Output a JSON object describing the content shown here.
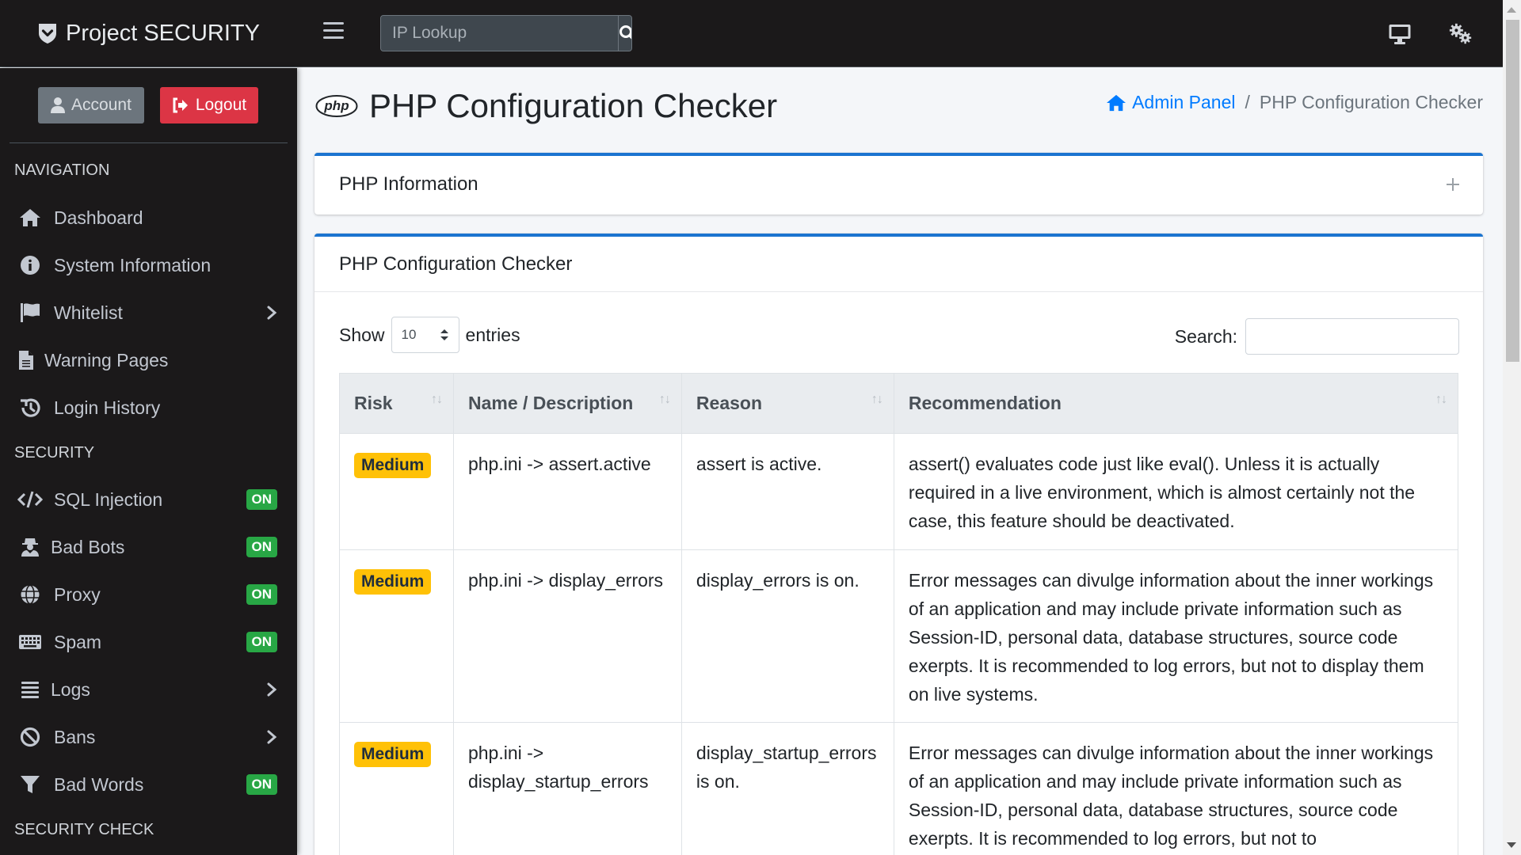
{
  "app": {
    "brand": "Project SECURITY",
    "brand_icon": "shield-check-icon"
  },
  "topbar": {
    "menu_icon": "hamburger-icon",
    "ip_lookup": {
      "placeholder": "IP Lookup",
      "value": "",
      "button_icon": "search-icon"
    },
    "right_icons": [
      "monitor-icon",
      "gears-icon"
    ]
  },
  "sidebar": {
    "account_label": "Account",
    "logout_label": "Logout",
    "sections": [
      {
        "header": "NAVIGATION",
        "items": [
          {
            "label": "Dashboard",
            "icon": "home-icon"
          },
          {
            "label": "System Information",
            "icon": "info-circle-icon"
          },
          {
            "label": "Whitelist",
            "icon": "flag-icon",
            "has_submenu": true
          },
          {
            "label": "Warning Pages",
            "icon": "file-icon"
          },
          {
            "label": "Login History",
            "icon": "history-icon"
          }
        ]
      },
      {
        "header": "SECURITY",
        "items": [
          {
            "label": "SQL Injection",
            "icon": "code-icon",
            "badge": "ON"
          },
          {
            "label": "Bad Bots",
            "icon": "user-secret-icon",
            "badge": "ON"
          },
          {
            "label": "Proxy",
            "icon": "globe-icon",
            "badge": "ON"
          },
          {
            "label": "Spam",
            "icon": "keyboard-icon",
            "badge": "ON"
          },
          {
            "label": "Logs",
            "icon": "list-icon",
            "has_submenu": true
          },
          {
            "label": "Bans",
            "icon": "ban-icon",
            "has_submenu": true
          },
          {
            "label": "Bad Words",
            "icon": "filter-icon",
            "badge": "ON"
          }
        ]
      },
      {
        "header": "SECURITY CHECK",
        "items": []
      }
    ]
  },
  "page": {
    "title": "PHP Configuration Checker",
    "title_icon": "php-logo-icon",
    "breadcrumb": {
      "home_label": "Admin Panel",
      "separator": "/",
      "current": "PHP Configuration Checker"
    }
  },
  "cards": {
    "info": {
      "title": "PHP Information",
      "toggle_icon": "plus-icon"
    },
    "checker": {
      "title": "PHP Configuration Checker",
      "show_label": "Show",
      "entries_label": "entries",
      "page_length": "10",
      "search_label": "Search:",
      "search_value": "",
      "columns": [
        "Risk",
        "Name / Description",
        "Reason",
        "Recommendation"
      ],
      "rows": [
        {
          "risk": "Medium",
          "name": "php.ini -> assert.active",
          "reason": "assert is active.",
          "recommendation": "assert() evaluates code just like eval(). Unless it is actually required in a live environment, which is almost certainly not the case, this feature should be deactivated."
        },
        {
          "risk": "Medium",
          "name": "php.ini -> display_errors",
          "reason": "display_errors is on.",
          "recommendation": "Error messages can divulge information about the inner workings of an application and may include private information such as Session-ID, personal data, database structures, source code exerpts. It is recommended to log errors, but not to display them on live systems."
        },
        {
          "risk": "Medium",
          "name": "php.ini -> display_startup_errors",
          "reason": "display_startup_errors is on.",
          "recommendation": "Error messages can divulge information about the inner workings of an application and may include private information such as Session-ID, personal data, database structures, source code exerpts. It is recommended to log errors, but not to"
        }
      ]
    }
  },
  "colors": {
    "sidebar_bg": "#1b191a",
    "accent_blue": "#1b74d0",
    "link_blue": "#007bff",
    "badge_on": "#28a745",
    "risk_medium": "#ffc107",
    "logout_red": "#dc3545"
  }
}
